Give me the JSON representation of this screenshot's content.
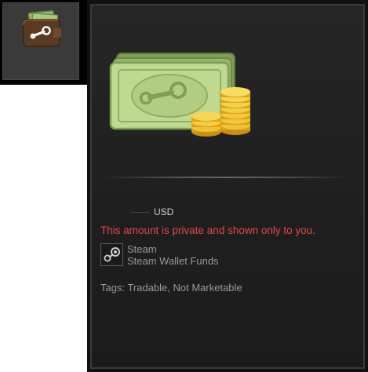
{
  "item": {
    "currency": "USD",
    "private_notice": "This amount is private and shown only to you.",
    "app_name": "Steam",
    "item_type": "Steam Wallet Funds",
    "tags": "Tags: Tradable, Not Marketable"
  },
  "colors": {
    "private_notice": "#e04848",
    "secondary_text": "#9a9a9a",
    "bill_green": "#b6cf85"
  }
}
